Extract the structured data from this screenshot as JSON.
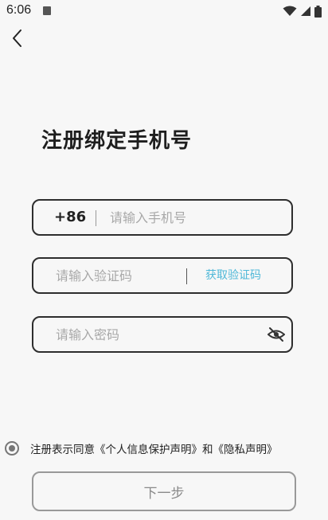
{
  "status_bar": {
    "time": "6:06",
    "icons": [
      "app-notification-icon",
      "wifi-icon",
      "signal-icon",
      "battery-icon"
    ]
  },
  "header": {
    "back_icon": "chevron-left-icon"
  },
  "page": {
    "title": "注册绑定手机号"
  },
  "form": {
    "phone": {
      "country_code": "+86",
      "placeholder": "请输入手机号",
      "value": ""
    },
    "code": {
      "placeholder": "请输入验证码",
      "value": "",
      "get_code_label": "获取验证码"
    },
    "password": {
      "placeholder": "请输入密码",
      "value": "",
      "toggle_icon": "eye-off-icon"
    }
  },
  "agreement": {
    "prefix": "注册表示同意",
    "personal_info_link": "《个人信息保护声明》",
    "joiner": "和",
    "privacy_link": "《隐私声明》"
  },
  "actions": {
    "next_label": "下一步"
  },
  "colors": {
    "background": "#f7f7f7",
    "accent": "#4fb8d8",
    "border": "#2e2e2e",
    "disabled": "#999999"
  }
}
